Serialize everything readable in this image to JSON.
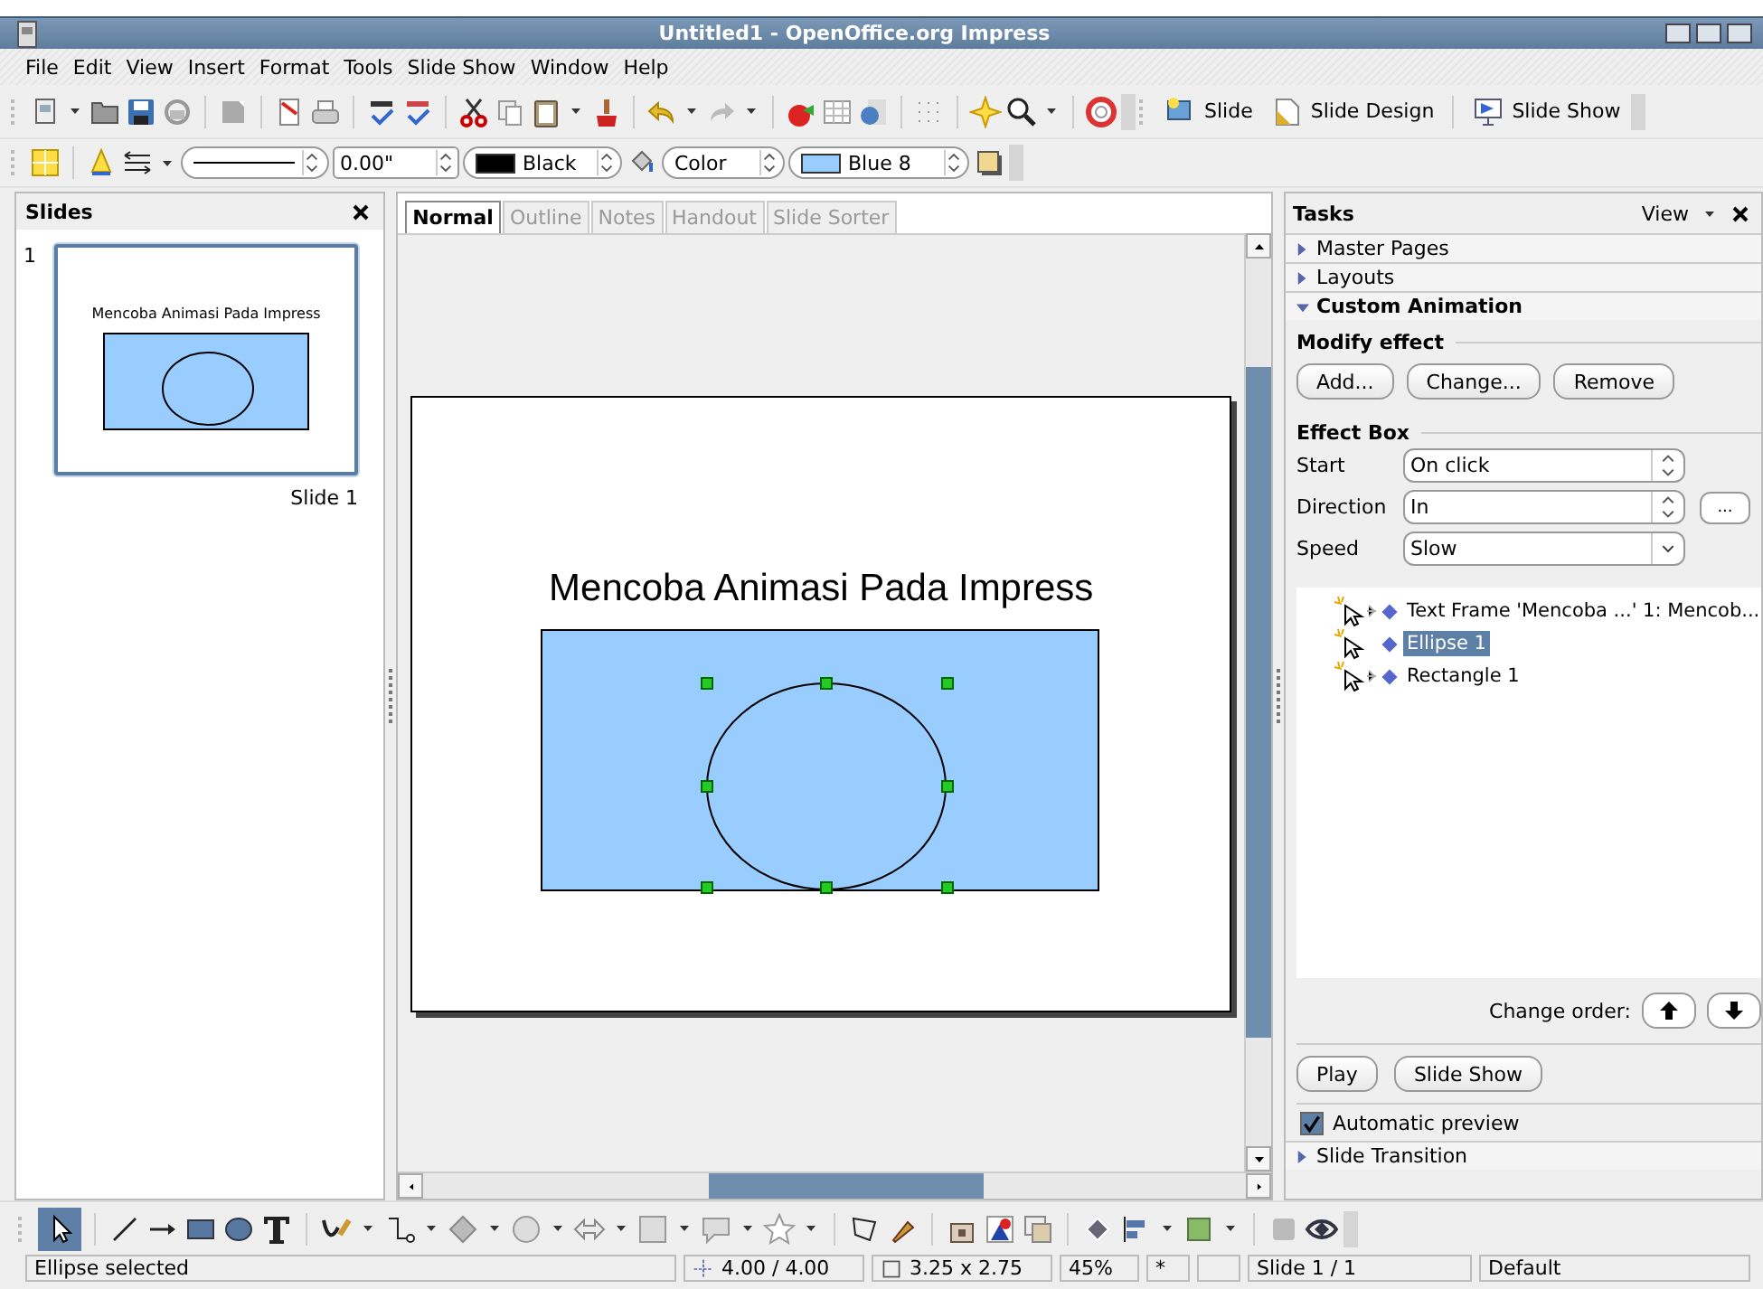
{
  "window": {
    "title": "Untitled1 - OpenOffice.org Impress"
  },
  "menu": [
    "File",
    "Edit",
    "View",
    "Insert",
    "Format",
    "Tools",
    "Slide Show",
    "Window",
    "Help"
  ],
  "toolbar": {
    "labeled_buttons": [
      "Slide",
      "Slide Design",
      "Slide Show"
    ]
  },
  "line_area_toolbar": {
    "line_width": "0.00\"",
    "line_color": "Black",
    "area_style": "Color",
    "area_color": "Blue 8"
  },
  "slides_panel": {
    "title": "Slides",
    "slides": [
      {
        "number": "1",
        "title": "Mencoba Animasi Pada Impress",
        "label": "Slide 1",
        "selected": true
      }
    ]
  },
  "view_tabs": [
    {
      "label": "Normal",
      "selected": true
    },
    {
      "label": "Outline",
      "selected": false
    },
    {
      "label": "Notes",
      "selected": false
    },
    {
      "label": "Handout",
      "selected": false
    },
    {
      "label": "Slide Sorter",
      "selected": false
    }
  ],
  "slide": {
    "title": "Mencoba Animasi Pada Impress",
    "ellipse_selected": true
  },
  "tasks": {
    "title": "Tasks",
    "view": "View",
    "sections": [
      {
        "label": "Master Pages",
        "expanded": false
      },
      {
        "label": "Layouts",
        "expanded": false
      },
      {
        "label": "Custom Animation",
        "expanded": true
      }
    ],
    "modify_effect": {
      "heading": "Modify effect",
      "buttons": [
        "Add...",
        "Change...",
        "Remove"
      ]
    },
    "effect_box": {
      "heading": "Effect Box",
      "fields": [
        {
          "kind": "spin",
          "label": "Start",
          "value": "On click"
        },
        {
          "kind": "spin",
          "label": "Direction",
          "value": "In",
          "button": "..."
        },
        {
          "kind": "dropdown",
          "label": "Speed",
          "value": "Slow"
        }
      ]
    },
    "effects": [
      {
        "label": "Text Frame 'Mencoba ...' 1: Mencob...",
        "selected": false
      },
      {
        "label": "Ellipse 1",
        "selected": true
      },
      {
        "label": "Rectangle 1",
        "selected": false
      }
    ],
    "change_order": "Change order:",
    "buttons": [
      "Play",
      "Slide Show"
    ],
    "automatic_preview": {
      "label": "Automatic preview",
      "checked": true
    },
    "footer_section": {
      "label": "Slide Transition",
      "expanded": false
    }
  },
  "drawing_toolbar": {
    "select_active": true
  },
  "status_bar": {
    "message": "Ellipse selected",
    "position": "4.00 / 4.00",
    "size": "3.25 x 2.75",
    "zoom": "45%",
    "modified": "*",
    "page": "Slide 1 / 1",
    "layout": "Default"
  }
}
